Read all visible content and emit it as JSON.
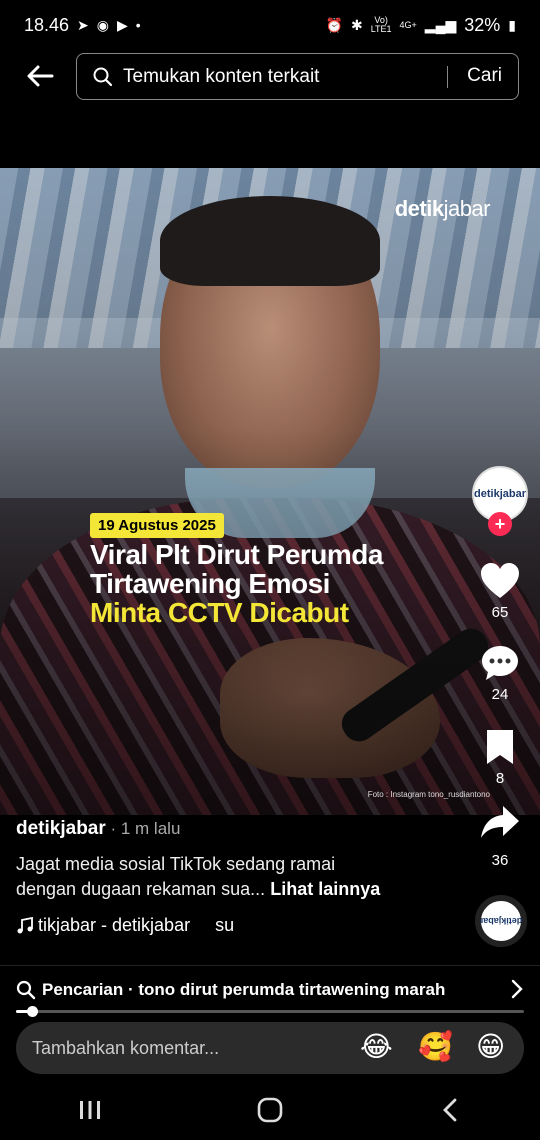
{
  "status_bar": {
    "time": "18.46",
    "battery": "32%",
    "network_top": "Vo)",
    "network_bottom": "LTE1",
    "network_type": "4G+"
  },
  "search": {
    "placeholder": "Temukan konten terkait",
    "button_label": "Cari"
  },
  "video": {
    "brand_bold": "detik",
    "brand_thin": "jabar",
    "date_badge": "19 Agustus 2025",
    "headline_line1": "Viral Plt Dirut Perumda",
    "headline_line2": "Tirtawening Emosi",
    "headline_line3": "Minta CCTV Dicabut",
    "photo_credit": "Foto : Instagram tono_rusdiantono"
  },
  "actions": {
    "avatar_label": "detikjabar",
    "likes": "65",
    "comments": "24",
    "bookmarks": "8",
    "shares": "36"
  },
  "post": {
    "author": "detikjabar",
    "time": " · 1 m lalu",
    "caption_line1": "Jagat media sosial TikTok sedang ramai",
    "caption_line2": "dengan dugaan rekaman sua...",
    "see_more": "Lihat lainnya",
    "sound": "tikjabar - detikjabar     su"
  },
  "suggestion": {
    "text": "Pencarian · tono dirut perumda tirtawening marah"
  },
  "progress": {
    "fraction": 0.032
  },
  "comment": {
    "placeholder": "Tambahkan komentar...",
    "emoji_1": "😂",
    "emoji_2": "🥰",
    "emoji_3": "😁"
  },
  "colors": {
    "accent_yellow": "#f3e637",
    "follow_red": "#fe2c55"
  },
  "icons": [
    "back-arrow-icon",
    "search-icon",
    "heart-icon",
    "comment-icon",
    "bookmark-icon",
    "share-icon",
    "music-note-icon",
    "chevron-right-icon"
  ]
}
